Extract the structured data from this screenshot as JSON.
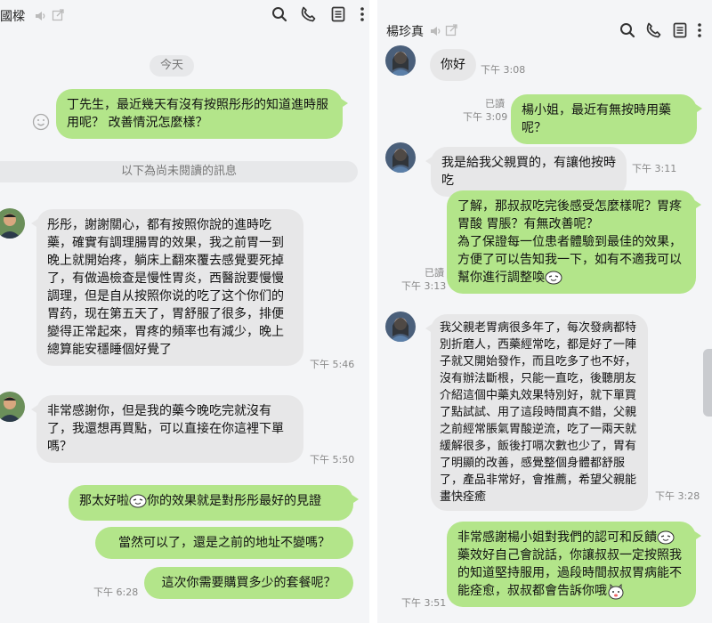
{
  "left": {
    "title": "國樑",
    "date_separator": "今天",
    "unread_notice": "以下為尚未閱讀的訊息",
    "msg1": "丁先生，最近幾天有沒有按照彤彤的知道進時服用呢？ 改善情況怎麼樣？",
    "msg2": "彤彤，謝謝關心，都有按照你說的進時吃藥，確實有調理腸胃的效果，我之前胃一到晚上就開始疼，躺床上翻來覆去感覺要死掉了，有做過檢查是慢性胃炎，西醫說要慢慢調理，但是自从按照你说的吃了这个你们的胃药，现在第五天了，胃舒服了很多，排便變得正常起來，胃疼的頻率也有減少，晚上總算能安穩睡個好覺了",
    "msg2_time": "下午 5:46",
    "msg3": "非常感謝你，但是我的藥今晚吃完就沒有了，我還想再買點，可以直接在你這裡下單嗎？",
    "msg3_time": "下午 5:50",
    "msg4_a": "那太好啦",
    "msg4_b": "你的效果就是對彤彤最好的見證",
    "msg5": "當然可以了，還是之前的地址不變嗎？",
    "msg6": "這次你需要購買多少的套餐呢？",
    "msg6_time": "下午 6:28"
  },
  "right": {
    "title": "楊珍真",
    "m0": "你好",
    "m0_time": "下午 3:08",
    "m1_read": "已讀",
    "m1_time": "下午 3:09",
    "m1": "楊小姐，最近有無按時用藥呢？",
    "m2": "我是給我父親買的，有讓他按時吃",
    "m2_time": "下午 3:11",
    "m3_line1": "了解，那叔叔吃完後感受怎麼樣呢？胃疼 胃酸 胃脹？有無改善呢？",
    "m3_line2": "為了保證每一位患者體驗到最佳的效果，方便了可以告知我一下，如有不適我可以幫你進行調整喚",
    "m3_read": "已讀",
    "m3_time": "下午 3:13",
    "m4": "我父親老胃病很多年了，每次發病都特別折磨人，西藥經常吃，都是好了一陣子就又開始發作，而且吃多了也不好，沒有辦法斷根，只能一直吃，後聽朋友介紹這個中藥丸效果特別好，就下單買了點試試、用了這段時間真不錯，父親之前經常脹氣胃酸逆流，吃了一兩天就緩解很多，飯後打嗝次數也少了，胃有了明顯的改善，感覺整個身體都舒服了，產品非常好，會推薦，希望父親能畫快痊癒",
    "m4_time": "下午 3:28",
    "m5_a": "非常感謝楊小姐對我們的認可和反饋",
    "m5_b": "藥效好自己會說話，你讓叔叔一定按照我的知道堅持服用，過段時間叔叔胃病能不能痊愈，叔叔都會告訴你哦",
    "m5_time": "下午 3:51"
  },
  "icons": [
    "mute-icon",
    "external-icon",
    "search-icon",
    "phone-icon",
    "notes-icon",
    "more-icon",
    "emoji-icon"
  ],
  "colors": {
    "out_bubble": "#b3e58a",
    "in_bubble": "#e7e7e8",
    "background": "#f4f5f7"
  }
}
